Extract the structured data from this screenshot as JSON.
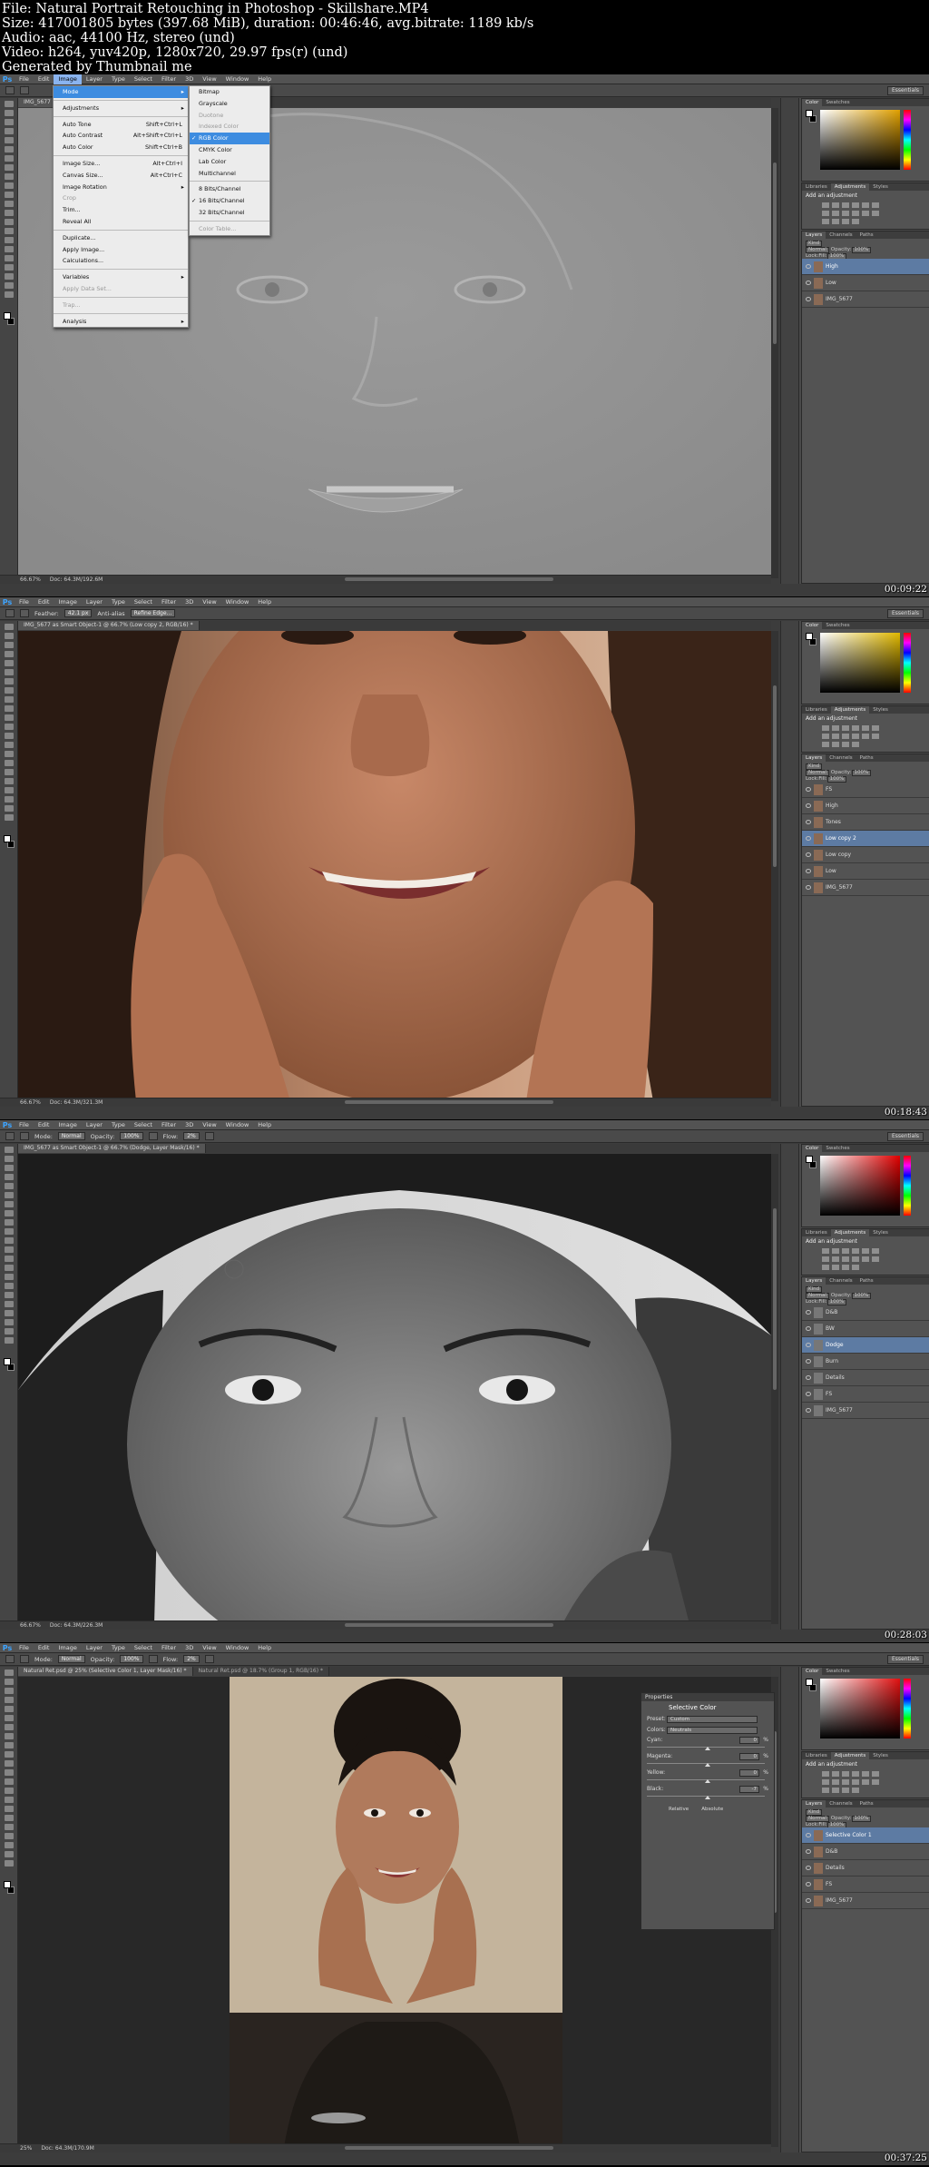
{
  "info": {
    "file": "File: Natural Portrait Retouching in Photoshop - Skillshare.MP4",
    "size": "Size: 417001805 bytes (397.68 MiB), duration: 00:46:46, avg.bitrate: 1189 kb/s",
    "audio": "Audio: aac, 44100 Hz, stereo (und)",
    "video": "Video: h264, yuv420p, 1280x720, 29.97 fps(r) (und)",
    "generated": "Generated by Thumbnail me"
  },
  "menubar": [
    "Ps",
    "File",
    "Edit",
    "Image",
    "Layer",
    "Type",
    "Select",
    "Filter",
    "3D",
    "View",
    "Window",
    "Help"
  ],
  "essentials": "Essentials",
  "colors": {
    "selection": "#5d7ba3",
    "menu_highlight": "#3d8ce0",
    "ui_dark": "#3c3c3c"
  },
  "right_panel": {
    "color_tabs": [
      "Color",
      "Swatches"
    ],
    "adj_tabs": [
      "Libraries",
      "Adjustments",
      "Styles"
    ],
    "add_adjustment": "Add an adjustment",
    "layer_tabs": [
      "Layers",
      "Channels",
      "Paths"
    ],
    "kind": "Kind",
    "blend": "Normal",
    "opacity_label": "Opacity:",
    "opacity": "100%",
    "lock_label": "Lock:",
    "fill_label": "Fill:",
    "fill": "100%"
  },
  "panels": [
    {
      "doc_tab": "IMG_5677",
      "status": "Doc: 64.3M/192.6M",
      "zoom": "66.67%",
      "timestamp": "00:09:22",
      "layers": [
        {
          "name": "High",
          "selected": true
        },
        {
          "name": "Low",
          "selected": false
        },
        {
          "name": "IMG_5677",
          "selected": false
        }
      ]
    },
    {
      "doc_tab": "IMG_5677 as Smart Object-1 @ 66.7% (Low copy 2, RGB/16) *",
      "options": {
        "feather_label": "Feather:",
        "feather": "42.1 px",
        "anti_alias": "Anti-alias",
        "refine": "Refine Edge..."
      },
      "status": "Doc: 64.3M/321.3M",
      "zoom": "66.67%",
      "timestamp": "00:18:43",
      "layers": [
        {
          "name": "FS",
          "selected": false
        },
        {
          "name": "High",
          "selected": false
        },
        {
          "name": "Tones",
          "selected": false
        },
        {
          "name": "Low copy 2",
          "selected": true
        },
        {
          "name": "Low copy",
          "selected": false
        },
        {
          "name": "Low",
          "selected": false
        },
        {
          "name": "IMG_5677",
          "selected": false
        }
      ]
    },
    {
      "doc_tab": "IMG_5677 as Smart Object-1 @ 66.7% (Dodge, Layer Mask/16) *",
      "options": {
        "mode_label": "Mode:",
        "mode": "Normal",
        "opacity_label": "Opacity:",
        "opacity": "100%",
        "flow_label": "Flow:",
        "flow": "2%"
      },
      "status": "Doc: 64.3M/226.3M",
      "zoom": "66.67%",
      "timestamp": "00:28:03",
      "layers": [
        {
          "name": "D&B",
          "selected": false
        },
        {
          "name": "BW",
          "selected": false
        },
        {
          "name": "Dodge",
          "selected": true
        },
        {
          "name": "Burn",
          "selected": false
        },
        {
          "name": "Details",
          "selected": false
        },
        {
          "name": "FS",
          "selected": false
        },
        {
          "name": "IMG_5677",
          "selected": false
        }
      ]
    },
    {
      "doc_tab": "Natural Ret.psd @ 25% (Selective Color 1, Layer Mask/16) *",
      "doc_tab_2": "Natural Ret.psd @ 18.7% (Group 1, RGB/16) *",
      "options": {
        "mode_label": "Mode:",
        "mode": "Normal",
        "opacity_label": "Opacity:",
        "opacity": "100%",
        "flow_label": "Flow:",
        "flow": "2%"
      },
      "status": "Doc: 64.3M/170.9M",
      "zoom": "25%",
      "timestamp": "00:37:25",
      "layers": [
        {
          "name": "Selective Color 1",
          "selected": true
        },
        {
          "name": "D&B",
          "selected": false
        },
        {
          "name": "Details",
          "selected": false
        },
        {
          "name": "FS",
          "selected": false
        },
        {
          "name": "IMG_5677",
          "selected": false
        }
      ],
      "properties": {
        "title": "Properties",
        "heading": "Selective Color",
        "preset_label": "Preset:",
        "preset": "Custom",
        "colors_label": "Colors:",
        "colors": "Neutrals",
        "sliders": [
          {
            "label": "Cyan:",
            "value": "0"
          },
          {
            "label": "Magenta:",
            "value": "0"
          },
          {
            "label": "Yellow:",
            "value": "0"
          },
          {
            "label": "Black:",
            "value": "-7"
          }
        ],
        "pct": "%",
        "relative": "Relative",
        "absolute": "Absolute"
      }
    }
  ],
  "image_menu": [
    {
      "label": "Mode",
      "arrow": true,
      "hl": true
    },
    {
      "sep": true
    },
    {
      "label": "Adjustments",
      "arrow": true
    },
    {
      "sep": true
    },
    {
      "label": "Auto Tone",
      "sc": "Shift+Ctrl+L"
    },
    {
      "label": "Auto Contrast",
      "sc": "Alt+Shift+Ctrl+L"
    },
    {
      "label": "Auto Color",
      "sc": "Shift+Ctrl+B"
    },
    {
      "sep": true
    },
    {
      "label": "Image Size...",
      "sc": "Alt+Ctrl+I"
    },
    {
      "label": "Canvas Size...",
      "sc": "Alt+Ctrl+C"
    },
    {
      "label": "Image Rotation",
      "arrow": true
    },
    {
      "label": "Crop",
      "dis": true
    },
    {
      "label": "Trim..."
    },
    {
      "label": "Reveal All"
    },
    {
      "sep": true
    },
    {
      "label": "Duplicate..."
    },
    {
      "label": "Apply Image..."
    },
    {
      "label": "Calculations..."
    },
    {
      "sep": true
    },
    {
      "label": "Variables",
      "arrow": true
    },
    {
      "label": "Apply Data Set...",
      "dis": true
    },
    {
      "sep": true
    },
    {
      "label": "Trap...",
      "dis": true
    },
    {
      "sep": true
    },
    {
      "label": "Analysis",
      "arrow": true
    }
  ],
  "mode_menu": [
    {
      "label": "Bitmap"
    },
    {
      "label": "Grayscale"
    },
    {
      "label": "Duotone",
      "dis": true
    },
    {
      "label": "Indexed Color",
      "dis": true
    },
    {
      "label": "RGB Color",
      "chk": true,
      "hl": true
    },
    {
      "label": "CMYK Color"
    },
    {
      "label": "Lab Color"
    },
    {
      "label": "Multichannel"
    },
    {
      "sep": true
    },
    {
      "label": "8 Bits/Channel"
    },
    {
      "label": "16 Bits/Channel",
      "chk": true
    },
    {
      "label": "32 Bits/Channel"
    },
    {
      "sep": true
    },
    {
      "label": "Color Table...",
      "dis": true
    }
  ]
}
